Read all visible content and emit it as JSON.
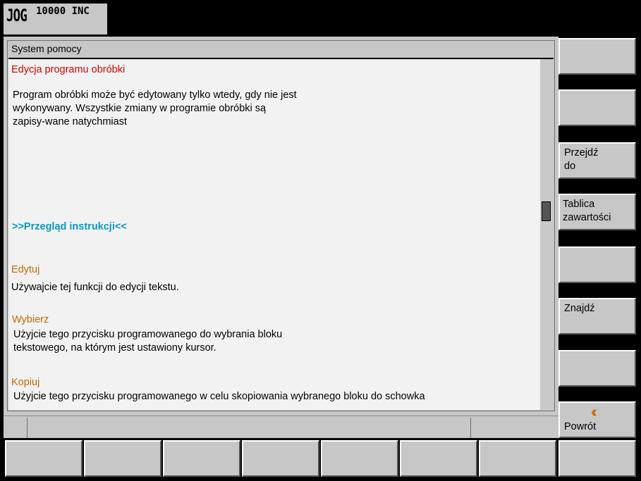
{
  "status_bar": {
    "mode": "JOG",
    "increment": "10000 INC"
  },
  "help": {
    "window_title": "System pomocy",
    "topic_title": "Edycja programu obróbki",
    "intro_lines": [
      "Program obróbki może być edytowany tylko wtedy, gdy nie jest",
      "wykonywany. Wszystkie zmiany w programie obróbki są",
      "zapisy-wane natychmiast"
    ],
    "link_label": ">>Przegląd instrukcji<<",
    "sections": [
      {
        "heading": "Edytuj",
        "lines": [
          "Używajcie tej funkcji do edycji tekstu."
        ]
      },
      {
        "heading": "Wybierz",
        "lines": [
          "Użyjcie tego przycisku programowanego do wybrania bloku",
          "tekstowego, na którym jest ustawiony kursor."
        ]
      },
      {
        "heading": "Kopiuj",
        "lines": [
          "Użyjcie tego przycisku programowanego w celu skopiowania wybranego bloku do schowka"
        ]
      }
    ]
  },
  "softkeys_vertical": [
    {
      "label": ""
    },
    {
      "label": ""
    },
    {
      "label": "Przejdź\ndo"
    },
    {
      "label": "Tablica\nzawartości"
    },
    {
      "label": ""
    },
    {
      "label": "Znajdź"
    },
    {
      "label": ""
    },
    {
      "label": "Powrót",
      "icon": "double-chevron-left-icon",
      "icon_color": "#d06a00"
    }
  ],
  "softkeys_horizontal": [
    "",
    "",
    "",
    "",
    "",
    "",
    "",
    ""
  ],
  "colors": {
    "topic_title": "#d20000",
    "link": "#0a98c0",
    "section_heading": "#c06a00",
    "panel_grey": "#c7c7c7"
  }
}
